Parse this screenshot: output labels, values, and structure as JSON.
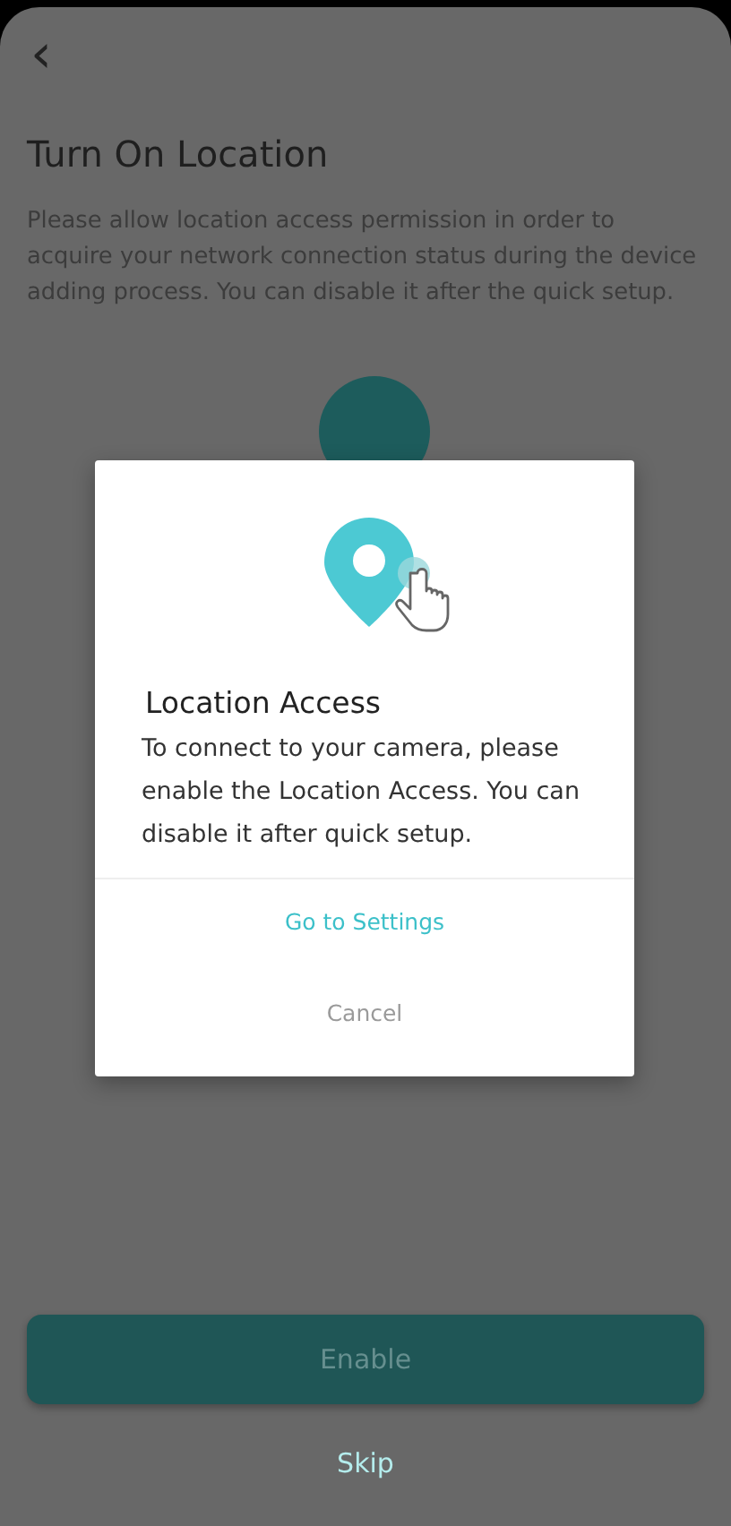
{
  "header": {
    "back": "‹"
  },
  "title": "Turn On Location",
  "description": "Please allow location access permission in order to acquire your network connection status during the device adding process. You can disable it after the quick setup.",
  "dialog": {
    "title": "Location Access",
    "message": "To connect to your camera, please enable the Location Access. You can disable it after quick setup.",
    "actions": [
      {
        "label": "Go to Settings",
        "kind": "primary"
      },
      {
        "label": "Cancel",
        "kind": "secondary"
      }
    ]
  },
  "primary_button": "Enable",
  "secondary_link": "Skip"
}
